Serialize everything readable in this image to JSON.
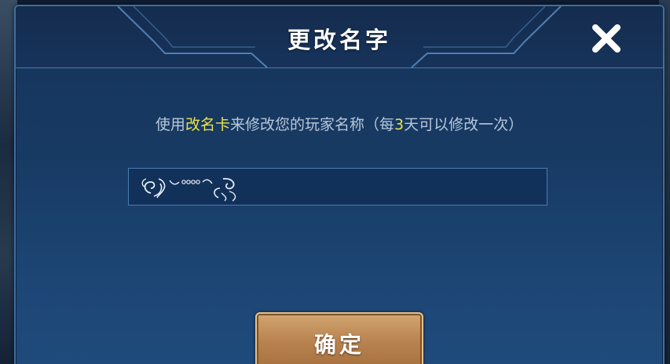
{
  "dialog": {
    "title": "更改名字",
    "close_icon": "close-x-icon",
    "instruction": {
      "part1": "使用",
      "item": "改名卡",
      "part2": "来修改您的玩家名称（每",
      "days": "3",
      "part3": "天可以修改一次）"
    },
    "name_input": {
      "value": "ঌ༺᭄·····৹ঌ",
      "value_kind": "decorative-symbol-name"
    },
    "confirm_label": "确定"
  },
  "colors": {
    "highlight": "#e9e24c",
    "dialog_border": "#3f6fa0",
    "button_gold": "#b98451"
  }
}
